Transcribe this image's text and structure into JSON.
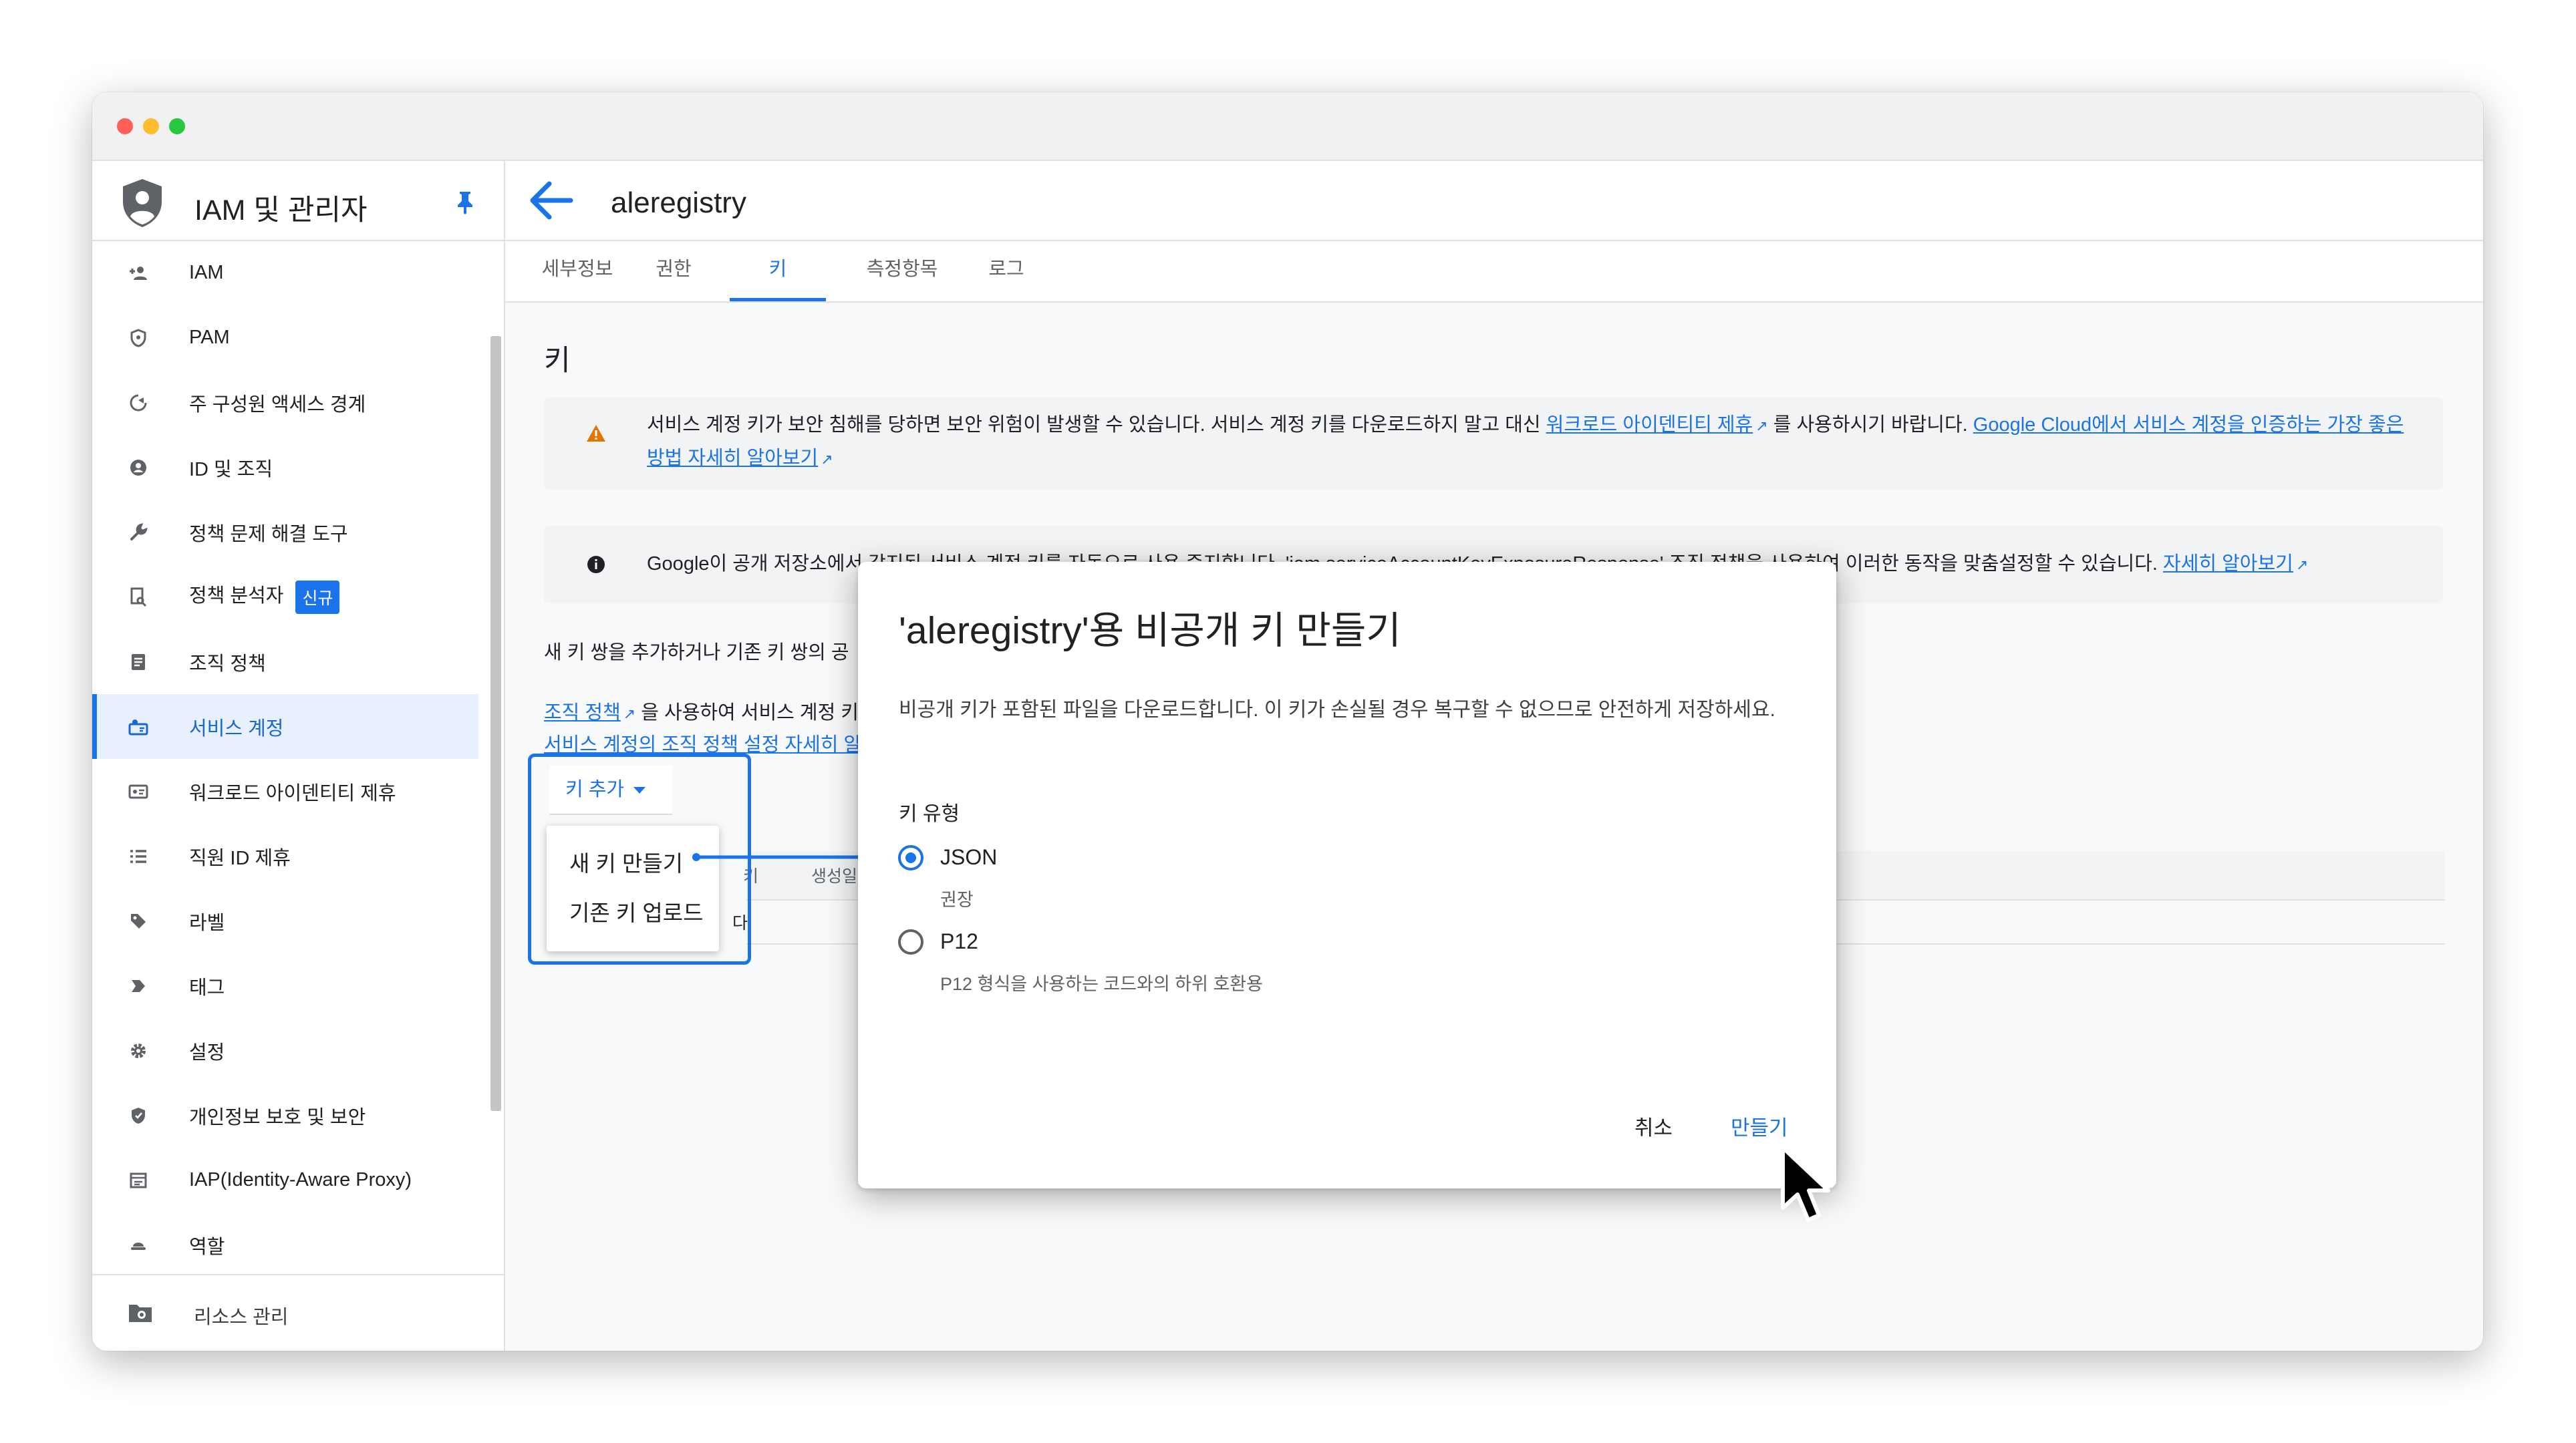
{
  "sidebar": {
    "title": "IAM 및 관리자",
    "items": [
      {
        "label": "IAM",
        "icon": "person-add-icon"
      },
      {
        "label": "PAM",
        "icon": "shield-icon"
      },
      {
        "label": "주 구성원 액세스 경계",
        "icon": "boundary-icon"
      },
      {
        "label": "ID 및 조직",
        "icon": "account-circle-icon"
      },
      {
        "label": "정책 문제 해결 도구",
        "icon": "wrench-icon"
      },
      {
        "label": "정책 분석자",
        "icon": "document-search-icon",
        "badge": "신규"
      },
      {
        "label": "조직 정책",
        "icon": "list-document-icon"
      },
      {
        "label": "서비스 계정",
        "icon": "service-account-icon",
        "active": true
      },
      {
        "label": "워크로드 아이덴티티 제휴",
        "icon": "id-card-icon"
      },
      {
        "label": "직원 ID 제휴",
        "icon": "list-icon"
      },
      {
        "label": "라벨",
        "icon": "label-icon"
      },
      {
        "label": "태그",
        "icon": "tag-icon"
      },
      {
        "label": "설정",
        "icon": "gear-icon"
      },
      {
        "label": "개인정보 보호 및 보안",
        "icon": "privacy-shield-icon"
      },
      {
        "label": "IAP(Identity-Aware Proxy)",
        "icon": "proxy-icon"
      },
      {
        "label": "역할",
        "icon": "role-hat-icon"
      }
    ],
    "footer": {
      "label": "리소스 관리",
      "icon": "folder-gear-icon"
    }
  },
  "main": {
    "title": "aleregistry",
    "tabs": [
      {
        "label": "세부정보"
      },
      {
        "label": "권한"
      },
      {
        "label": "키",
        "active": true
      },
      {
        "label": "측정항목"
      },
      {
        "label": "로그"
      }
    ],
    "section_title": "키",
    "warning": {
      "text_1": "서비스 계정 키가 보안 침해를 당하면 보안 위험이 발생할 수 있습니다. 서비스 계정 키를 다운로드하지 말고 대신 ",
      "link_1": "워크로드 아이덴티티 제휴",
      "text_2": " 를 사용하시기 바랍니다. ",
      "link_2": "Google Cloud에서 서비스 계정을 인증하는 가장 좋은 방법 자세히 알아보기"
    },
    "info": {
      "text": "Google이 공개 저장소에서 감지된 서비스 계정 키를 자동으로 사용 중지합니다. 'iam.serviceAccountKeyExposureResponse' 조직 정책을 사용하여 이러한 동작을 맞춤설정할 수 있습니다. ",
      "link": "자세히 알아보기"
    },
    "add_pair_text": "새 키 쌍을 추가하거나 기존 키 쌍의 공",
    "org_policy_link": "조직 정책",
    "org_policy_text": " 을 사용하여 서비스 계정 키",
    "org_policy_learn": "서비스 계정의 조직 정책 설정 자세히 알",
    "add_key_button": "키 추가",
    "menu": [
      "새 키 만들기",
      "기존 키 업로드"
    ],
    "table_headers": [
      "키",
      "생성일"
    ],
    "table_fragment": "다."
  },
  "dialog": {
    "title": "'aleregistry'용 비공개 키 만들기",
    "description": "비공개 키가 포함된 파일을 다운로드합니다. 이 키가 손실될 경우 복구할 수 없으므로 안전하게 저장하세요.",
    "key_type_label": "키 유형",
    "options": [
      {
        "label": "JSON",
        "sub": "권장",
        "selected": true
      },
      {
        "label": "P12",
        "sub": "P12 형식을 사용하는 코드와의 하위 호환용",
        "selected": false
      }
    ],
    "cancel": "취소",
    "create": "만들기"
  },
  "colors": {
    "accent": "#1a73e8",
    "warning": "#e37400"
  }
}
